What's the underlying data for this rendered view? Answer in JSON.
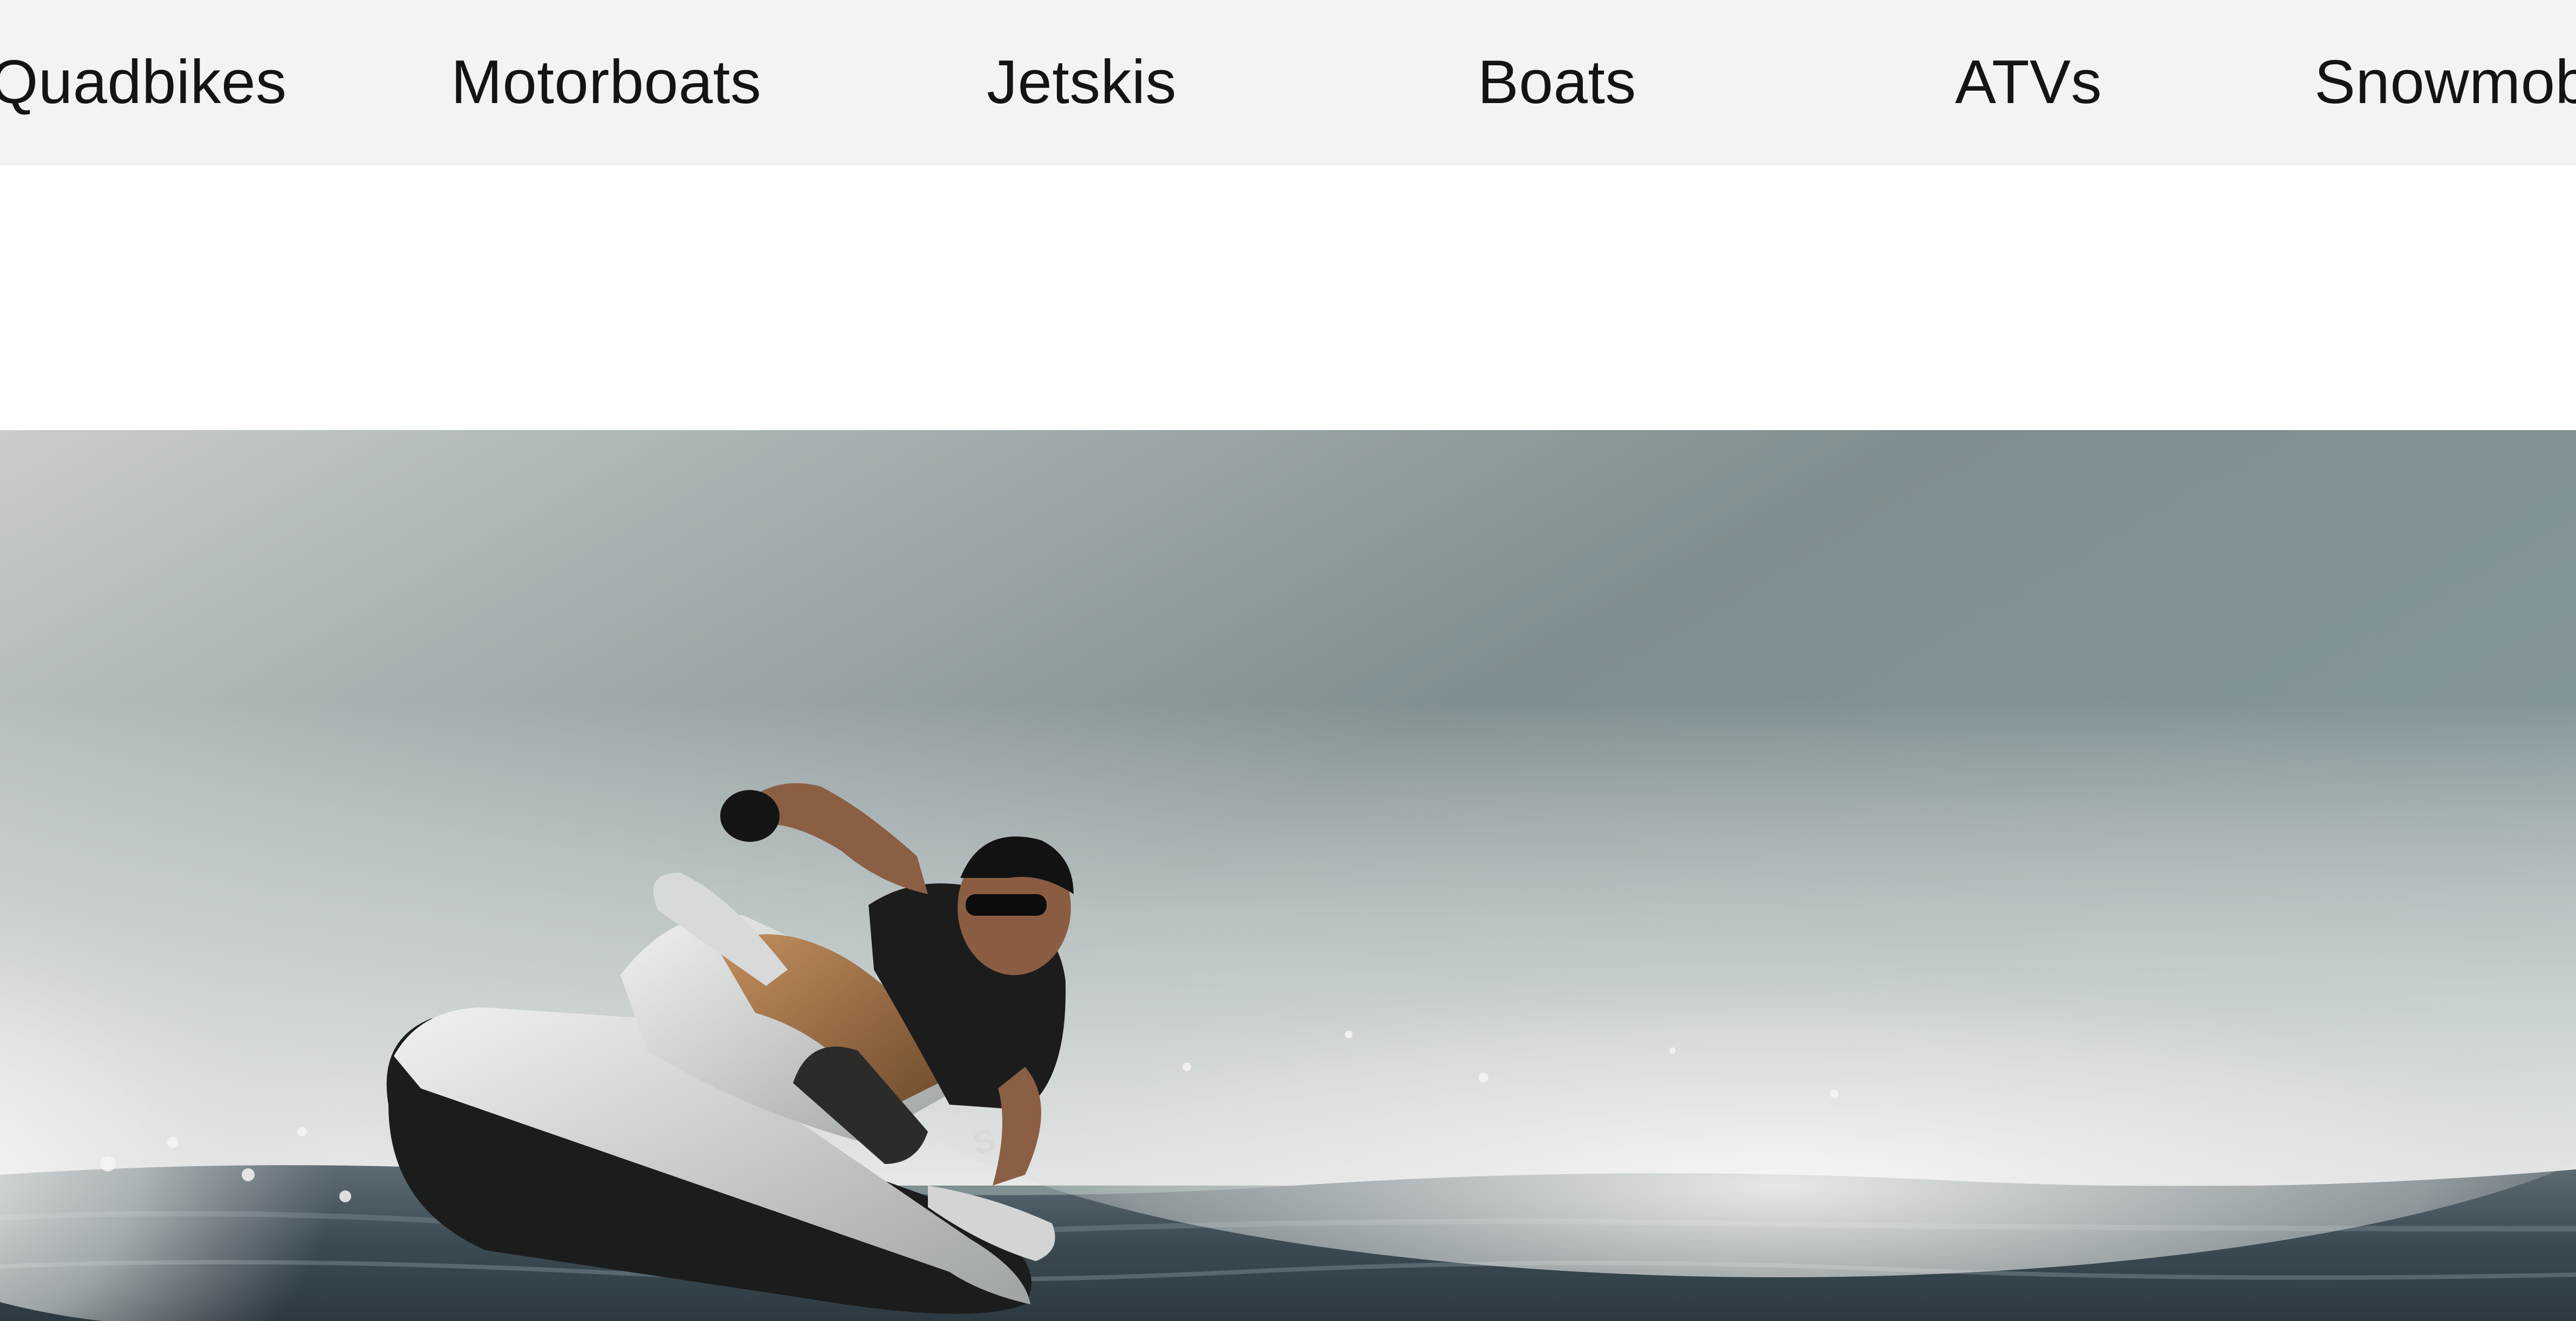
{
  "nav": {
    "items": [
      {
        "label": "Quadbikes"
      },
      {
        "label": "Motorboats"
      },
      {
        "label": "Jetskis"
      },
      {
        "label": "Boats"
      },
      {
        "label": "ATVs"
      },
      {
        "label": "Snowmobiles"
      }
    ]
  },
  "hero": {
    "image": "jetski-rider-photo",
    "jetski_hull_text": "S"
  },
  "colors": {
    "nav_background": "#f3f3f5",
    "nav_text": "#141414",
    "page_background": "#ffffff",
    "sky": "#7e8d8f",
    "spray": "#dcdedd",
    "water": "#3a4a52"
  }
}
